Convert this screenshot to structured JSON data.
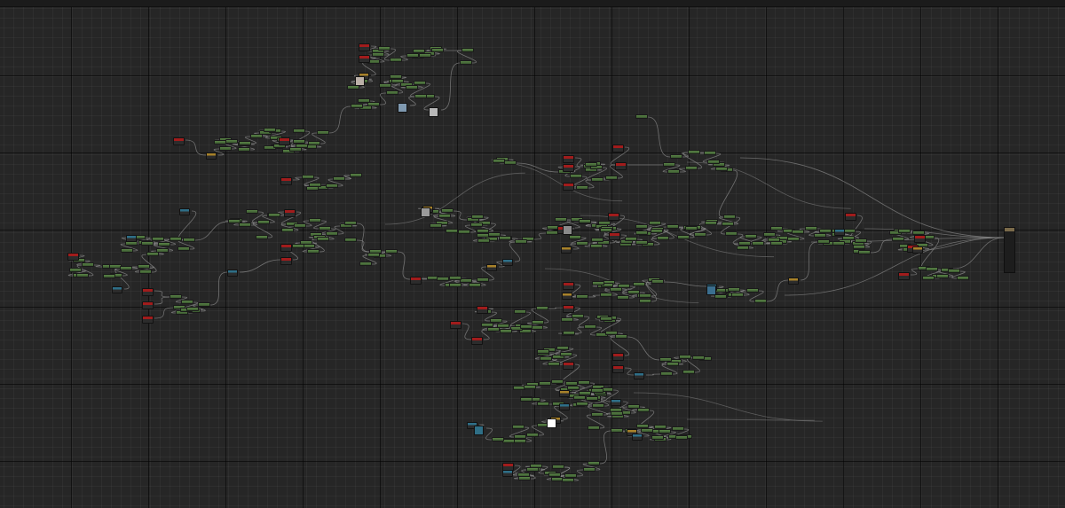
{
  "editor": {
    "kind": "material-node-graph",
    "wire_color": "#8a8a8a",
    "colors": {
      "background": "#262626",
      "grid": "#151515",
      "node_header_green": "#557d43",
      "node_header_red": "#a11c1c",
      "node_header_orange": "#a8822a",
      "node_header_blue": "#2e6f88"
    }
  },
  "output_node": {
    "icon": "material-output-node",
    "header_color": "#7a6a4a"
  }
}
